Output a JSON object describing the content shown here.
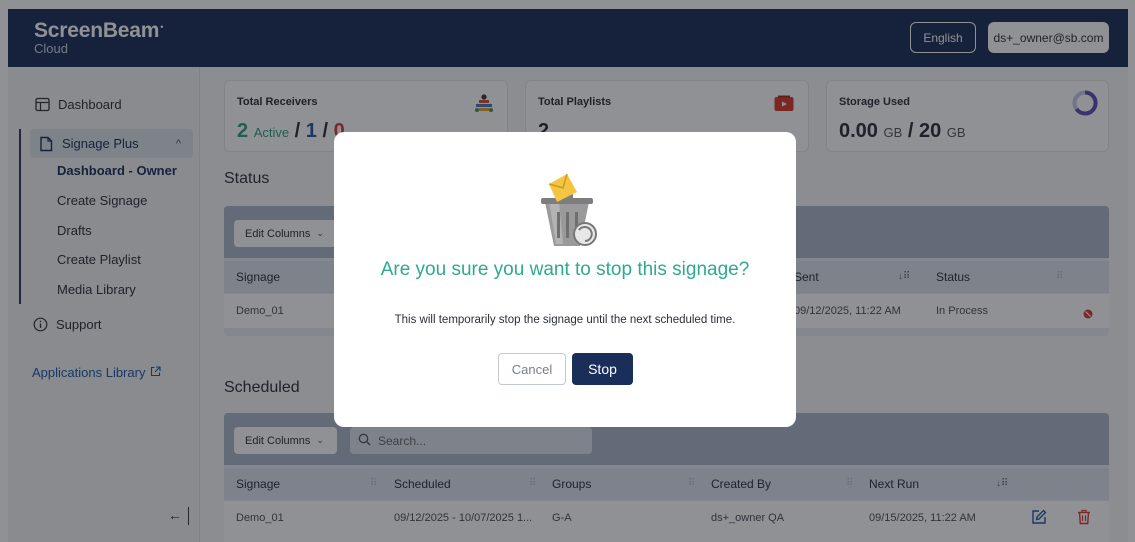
{
  "header": {
    "brand": "ScreenBeam",
    "brand_sub": "Cloud",
    "language": "English",
    "user_email": "ds+_owner@sb.com"
  },
  "sidebar": {
    "dashboard": "Dashboard",
    "signage_plus": "Signage Plus",
    "sub_items": [
      "Dashboard - Owner",
      "Create Signage",
      "Drafts",
      "Create Playlist",
      "Media Library"
    ],
    "support": "Support",
    "apps_library": "Applications Library"
  },
  "cards": {
    "receivers": {
      "title": "Total Receivers",
      "active_count": "2",
      "active_label": "Active",
      "sep": "/",
      "second_count": "1",
      "third_count": "0"
    },
    "playlists": {
      "title": "Total Playlists",
      "count": "2"
    },
    "storage": {
      "title": "Storage Used",
      "used": "0.00",
      "used_unit": "GB",
      "sep": "/",
      "total": "20",
      "total_unit": "GB"
    }
  },
  "status_section": {
    "title": "Status",
    "edit_columns": "Edit Columns",
    "columns": {
      "signage": "Signage",
      "sent": "Sent",
      "status": "Status"
    },
    "row": {
      "signage": "Demo_01",
      "sent": "09/12/2025, 11:22 AM",
      "status": "In Process"
    }
  },
  "scheduled_section": {
    "title": "Scheduled",
    "edit_columns": "Edit Columns",
    "search_placeholder": "Search...",
    "columns": {
      "signage": "Signage",
      "scheduled": "Scheduled",
      "groups": "Groups",
      "created_by": "Created By",
      "next_run": "Next Run"
    },
    "row": {
      "signage": "Demo_01",
      "scheduled": "09/12/2025 - 10/07/2025 1...",
      "groups": "G-A",
      "created_by": "ds+_owner QA",
      "next_run": "09/15/2025, 11:22 AM"
    }
  },
  "modal": {
    "title": "Are you sure you want to stop this signage?",
    "message": "This will temporarily stop the signage until the next scheduled time.",
    "cancel": "Cancel",
    "stop": "Stop"
  },
  "colors": {
    "header_bg": "#1a2e5a",
    "accent_green": "#2fa98f",
    "primary_button": "#1a2e5a",
    "delete_red": "#d73a3a"
  },
  "icons": [
    "dashboard-icon",
    "document-icon",
    "chevron-up-icon",
    "info-circle-icon",
    "external-link-icon",
    "collapse-left-icon",
    "receivers-icon",
    "playlist-icon",
    "storage-ring-icon",
    "search-icon",
    "stop-circle-icon",
    "edit-icon",
    "trash-icon",
    "trash-can-illustration"
  ]
}
